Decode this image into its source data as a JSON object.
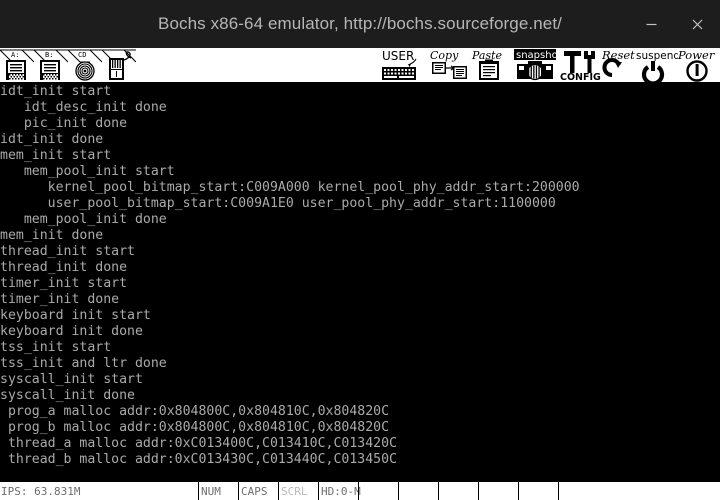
{
  "window": {
    "title": "Bochs x86-64 emulator, http://bochs.sourceforge.net/",
    "titlebar_bg": "#1d1d1d",
    "title_color": "#b6b6b6",
    "controls": [
      {
        "name": "minimize-button",
        "glyph": "minimize-icon"
      },
      {
        "name": "close-button",
        "glyph": "close-icon"
      }
    ]
  },
  "toolbar": {
    "bg": "#ffffff",
    "fg": "#000000",
    "left_items": [
      {
        "name": "floppy-a-button",
        "label": "A:",
        "icon": "floppy-disk-icon"
      },
      {
        "name": "floppy-b-button",
        "label": "B:",
        "icon": "floppy-disk-icon"
      },
      {
        "name": "cdrom-button",
        "label": "CD",
        "icon": "cdrom-disc-icon"
      },
      {
        "name": "mouse-button",
        "label": "",
        "icon": "mouse-icon"
      }
    ],
    "right_items": [
      {
        "name": "user-button",
        "label": "USER",
        "icon": "keyboard-icon"
      },
      {
        "name": "copy-button",
        "label": "Copy",
        "icon": "copy-pages-icon"
      },
      {
        "name": "paste-button",
        "label": "Paste",
        "icon": "clipboard-icon"
      },
      {
        "name": "snapshot-button",
        "label": "snapshot",
        "icon": "camera-icon"
      },
      {
        "name": "config-button",
        "label": "CONFIG",
        "icon": "hammer-wrench-icon"
      },
      {
        "name": "reset-button",
        "label": "Reset",
        "icon": "reset-arrow-icon"
      },
      {
        "name": "suspend-button",
        "label": "suspend",
        "icon": "suspend-power-icon"
      },
      {
        "name": "power-button",
        "label": "Power",
        "icon": "power-circle-icon"
      }
    ]
  },
  "screen": {
    "bg": "#000000",
    "fg": "#aaaaaa",
    "lines": [
      "idt_init start",
      "   idt_desc_init done",
      "   pic_init done",
      "idt_init done",
      "mem_init start",
      "   mem_pool_init start",
      "      kernel_pool_bitmap_start:C009A000 kernel_pool_phy_addr_start:200000",
      "      user_pool_bitmap_start:C009A1E0 user_pool_phy_addr_start:1100000",
      "   mem_pool_init done",
      "mem_init done",
      "thread_init start",
      "thread_init done",
      "timer_init start",
      "timer_init done",
      "keyboard init start",
      "keyboard init done",
      "tss_init start",
      "tss_init and ltr done",
      "syscall_init start",
      "syscall_init done",
      " prog_a malloc addr:0x804800C,0x804810C,0x804820C",
      " prog_b malloc addr:0x804800C,0x804810C,0x804820C",
      " thread_a malloc addr:0xC013400C,C013410C,C013420C",
      " thread_b malloc addr:0xC013430C,C013440C,C013450C"
    ]
  },
  "statusbar": {
    "bg": "#ffffff",
    "ips": "IPS: 63.831M",
    "indicators": [
      {
        "name": "status-num-lock",
        "label": "NUM",
        "state": "on"
      },
      {
        "name": "status-caps-lock",
        "label": "CAPS",
        "state": "on"
      },
      {
        "name": "status-scroll-lock",
        "label": "SCRL",
        "state": "off"
      },
      {
        "name": "status-hd-activity",
        "label": "HD:0-M",
        "state": "on"
      },
      {
        "name": "status-slot-5",
        "label": "",
        "state": "blank"
      },
      {
        "name": "status-slot-6",
        "label": "",
        "state": "blank"
      },
      {
        "name": "status-slot-7",
        "label": "",
        "state": "blank"
      },
      {
        "name": "status-slot-8",
        "label": "",
        "state": "blank"
      },
      {
        "name": "status-slot-9",
        "label": "",
        "state": "blank"
      },
      {
        "name": "status-slot-10",
        "label": "",
        "state": "blank"
      }
    ]
  }
}
